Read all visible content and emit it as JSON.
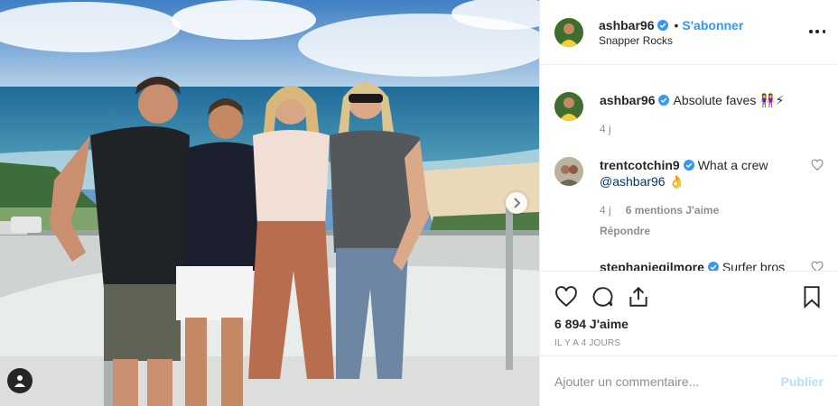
{
  "post": {
    "author": {
      "username": "ashbar96",
      "verified": true,
      "follow_label": "S'abonner",
      "separator": "•",
      "location": "Snapper Rocks"
    },
    "more_icon": "more-horizontal-icon",
    "comments": [
      {
        "username": "ashbar96",
        "verified": true,
        "text": "Absolute faves 👭⚡",
        "time": "4 j"
      },
      {
        "username": "trentcotchin9",
        "verified": true,
        "text": "What a crew",
        "mention": "@ashbar96",
        "emoji": "👌",
        "time": "4 j",
        "likes": "6 mentions J'aime",
        "reply_label": "Répondre"
      },
      {
        "username": "stephaniegilmore",
        "verified": true,
        "text": "Surfer bros",
        "emoji": "😎😎"
      }
    ],
    "likes": "6 894 J'aime",
    "date": "IL Y A 4 JOURS",
    "comment_input_placeholder": "Ajouter un commentaire...",
    "publish_label": "Publier"
  },
  "colors": {
    "link_blue": "#3897f0",
    "muted": "#8e8e8e",
    "text": "#262626",
    "publish_disabled": "#b2dffc",
    "verified_blue": "#3897f0"
  }
}
